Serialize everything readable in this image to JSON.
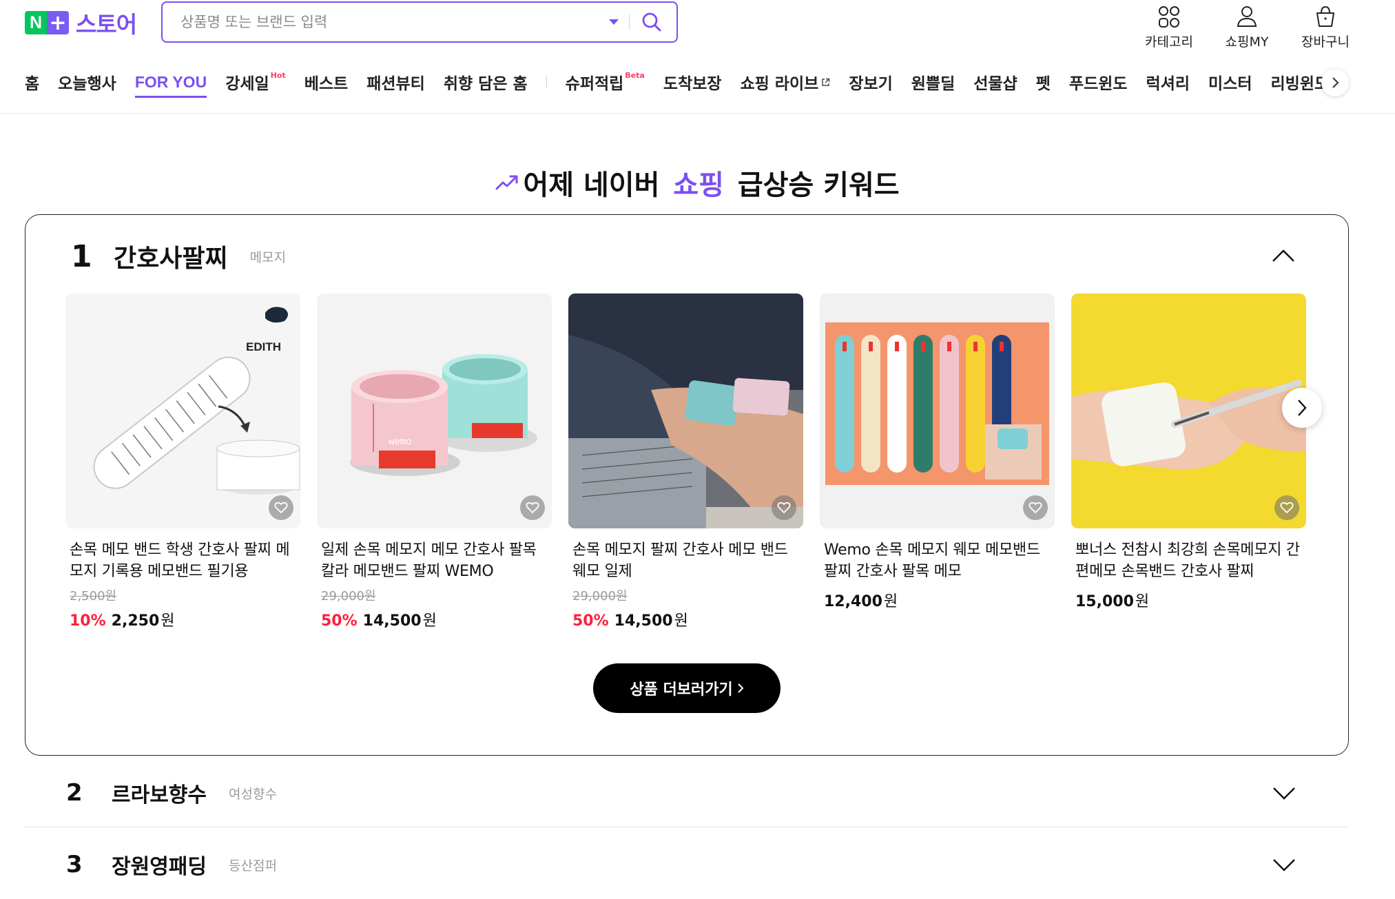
{
  "logo": {
    "n": "N",
    "plus": "+",
    "text": "스토어"
  },
  "search": {
    "placeholder": "상품명 또는 브랜드 입력"
  },
  "utils": [
    {
      "label": "카테고리",
      "icon": "category-icon"
    },
    {
      "label": "쇼핑MY",
      "icon": "user-icon"
    },
    {
      "label": "장바구니",
      "icon": "cart-icon"
    }
  ],
  "nav": {
    "items": [
      {
        "label": "홈"
      },
      {
        "label": "오늘행사"
      },
      {
        "label": "FOR YOU",
        "active": true
      },
      {
        "label": "강세일",
        "badge": "Hot"
      },
      {
        "label": "베스트"
      },
      {
        "label": "패션뷰티"
      },
      {
        "label": "취향 담은 홈"
      },
      {
        "label": "슈퍼적립",
        "badge": "Beta"
      },
      {
        "label": "도착보장"
      },
      {
        "label": "쇼핑 라이브"
      },
      {
        "label": "장보기"
      },
      {
        "label": "원쁠딜"
      },
      {
        "label": "선물샵"
      },
      {
        "label": "펫"
      },
      {
        "label": "푸드윈도"
      },
      {
        "label": "럭셔리"
      },
      {
        "label": "미스터"
      },
      {
        "label": "리빙윈도"
      }
    ]
  },
  "section": {
    "title_pre": "어제 네이버 ",
    "title_hl": "쇼핑",
    "title_post": " 급상승 키워드"
  },
  "keywords": [
    {
      "rank": "1",
      "word": "간호사팔찌",
      "sub": "메모지",
      "products": [
        {
          "name": "손목 메모 밴드 학생 간호사 팔찌 메모지 기록용 메모밴드 필기용",
          "orig": "2,500원",
          "discount": "10%",
          "price": "2,250",
          "won": "원",
          "image_text": "EDITH"
        },
        {
          "name": "일제 손목 메모지 메모 간호사 팔목 칼라 메모밴드 팔찌 WEMO",
          "orig": "29,000원",
          "discount": "50%",
          "price": "14,500",
          "won": "원",
          "image_text": "wemo"
        },
        {
          "name": "손목 메모지 팔찌 간호사 메모 밴드 웨모 일제",
          "orig": "29,000원",
          "discount": "50%",
          "price": "14,500",
          "won": "원"
        },
        {
          "name": "Wemo 손목 메모지 웨모 메모밴드 팔찌 간호사 팔목 메모",
          "orig": "",
          "discount": "",
          "price": "12,400",
          "won": "원"
        },
        {
          "name": "뽀너스 전참시 최강희 손목메모지 간편메모 손목밴드 간호사 팔찌",
          "orig": "",
          "discount": "",
          "price": "15,000",
          "won": "원"
        }
      ],
      "more_label": "상품 더보러가기"
    },
    {
      "rank": "2",
      "word": "르라보향수",
      "sub": "여성향수"
    },
    {
      "rank": "3",
      "word": "장원영패딩",
      "sub": "등산점퍼"
    }
  ],
  "colors": {
    "brand_purple": "#7b4ff2",
    "naver_green": "#03c75a",
    "discount_red": "#ff1f3d"
  }
}
